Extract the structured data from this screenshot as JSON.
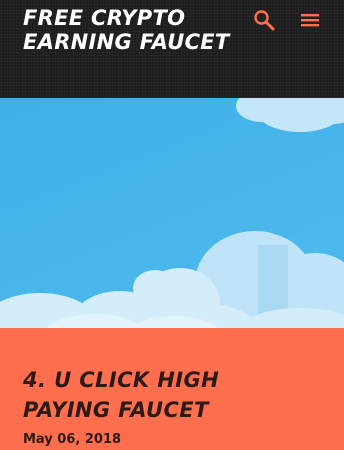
{
  "header": {
    "site_title": "FREE CRYPTO EARNING FAUCET",
    "search_icon": "search-icon",
    "menu_icon": "hamburger-menu-icon",
    "accent_color": "#ff6e4d"
  },
  "post": {
    "title": "4. U CLICK HIGH PAYING FAUCET",
    "date": "May 06, 2018"
  },
  "colors": {
    "header_bg": "#1d1d1d",
    "hero_sky": "#44b3e9",
    "content_bg": "#ff6e4d",
    "title_text": "#2b1a17"
  }
}
